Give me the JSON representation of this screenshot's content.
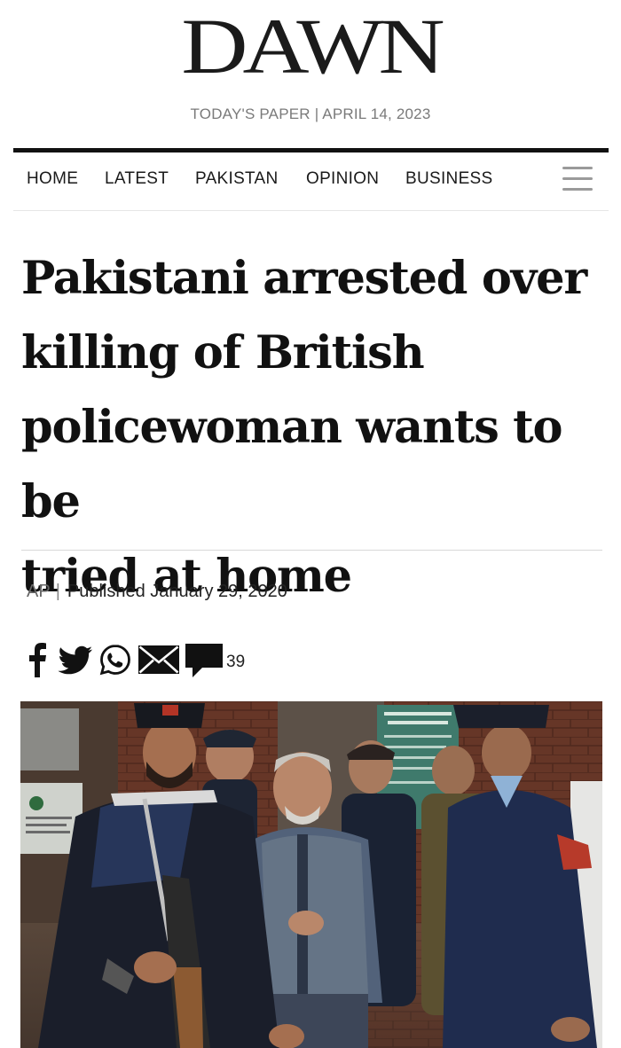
{
  "masthead": {
    "logo": "DAWN",
    "paper_date": "TODAY'S PAPER | APRIL 14, 2023"
  },
  "nav": {
    "items": [
      {
        "label": "HOME"
      },
      {
        "label": "LATEST"
      },
      {
        "label": "PAKISTAN"
      },
      {
        "label": "OPINION"
      },
      {
        "label": "BUSINESS"
      }
    ],
    "menu_icon": "hamburger-menu-icon"
  },
  "article": {
    "headline_lines": [
      "Pakistani arrested over",
      "killing of British",
      "policewoman wants to be",
      "tried at home"
    ],
    "source": "AP",
    "separator": "|",
    "published": "Published January 29, 2020",
    "comment_count": "39"
  },
  "share_icons": [
    "facebook-icon",
    "twitter-icon",
    "whatsapp-icon",
    "email-icon",
    "comment-icon"
  ],
  "photo": {
    "sign_text": [
      "CCRIC/ADMIN",
      "051-9208294",
      "FB.COM/CHIEF",
      "CHIEF COMPLAINT"
    ],
    "sign_urdu": "ہیلو"
  },
  "colors": {
    "ink": "#111111",
    "muted": "#7a7a7a",
    "menu": "#9a9a9a",
    "rule": "#d8d8d8"
  }
}
